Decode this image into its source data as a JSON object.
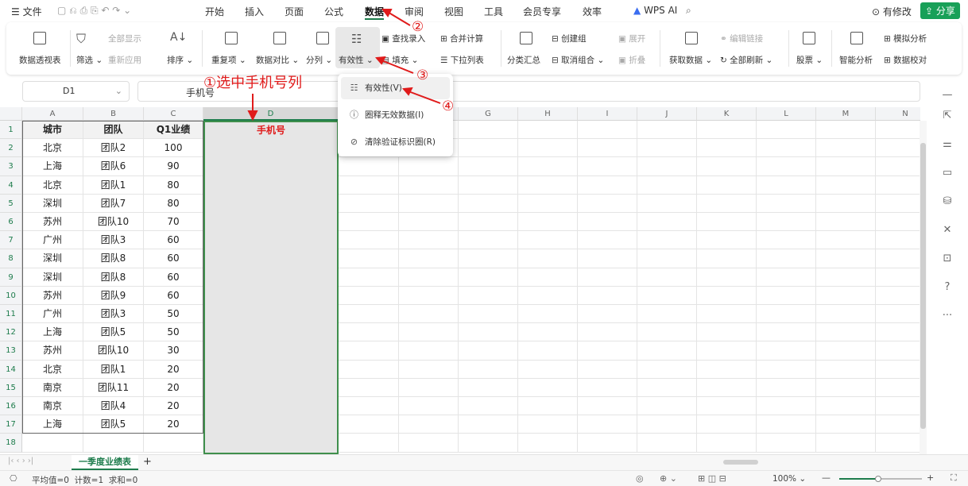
{
  "menu": {
    "hamburger": "☰",
    "file": "文件",
    "tabs": [
      "开始",
      "插入",
      "页面",
      "公式",
      "数据",
      "审阅",
      "视图",
      "工具",
      "会员专享",
      "效率"
    ],
    "active_tab": "数据",
    "wps_ai": "WPS AI",
    "changes": "有修改",
    "share": "分享"
  },
  "ribbon": {
    "pivot": "数据透视表",
    "filter": "筛选",
    "show_all": "全部显示",
    "reapply": "重新应用",
    "sort": "排序",
    "duplicates": "重复项",
    "compare": "数据对比",
    "split": "分列",
    "validity": "有效性",
    "find_input": "查找录入",
    "fill": "填充",
    "merge_calc": "合并计算",
    "dropdown_list": "下拉列表",
    "subtotal": "分类汇总",
    "create_group": "创建组",
    "ungroup": "取消组合",
    "expand": "展开",
    "collapse": "折叠",
    "get_data": "获取数据",
    "edit_links": "编辑链接",
    "refresh_all": "全部刷新",
    "stocks": "股票",
    "smart_analysis": "智能分析",
    "what_if": "模拟分析",
    "data_check": "数据校对"
  },
  "formula_bar": {
    "name_box": "D1",
    "fx": "fx",
    "content": "手机号"
  },
  "dropdown_menu": {
    "items": [
      "有效性(V)",
      "圈释无效数据(I)",
      "清除验证标识圈(R)"
    ]
  },
  "annotations": {
    "step1": "①选中手机号列",
    "step2": "②",
    "step3": "③",
    "step4": "④"
  },
  "sheet": {
    "columns": [
      "A",
      "B",
      "C",
      "D",
      "E",
      "F",
      "G",
      "H",
      "I",
      "J",
      "K",
      "L",
      "M",
      "N"
    ],
    "rows": [
      "1",
      "2",
      "3",
      "4",
      "5",
      "6",
      "7",
      "8",
      "9",
      "10",
      "11",
      "12",
      "13",
      "14",
      "15",
      "16",
      "17",
      "18"
    ],
    "header": [
      "城市",
      "团队",
      "Q1业绩",
      "手机号"
    ],
    "data": [
      [
        "北京",
        "团队2",
        "100"
      ],
      [
        "上海",
        "团队6",
        "90"
      ],
      [
        "北京",
        "团队1",
        "80"
      ],
      [
        "深圳",
        "团队7",
        "80"
      ],
      [
        "苏州",
        "团队10",
        "70"
      ],
      [
        "广州",
        "团队3",
        "60"
      ],
      [
        "深圳",
        "团队8",
        "60"
      ],
      [
        "深圳",
        "团队8",
        "60"
      ],
      [
        "苏州",
        "团队9",
        "60"
      ],
      [
        "广州",
        "团队3",
        "50"
      ],
      [
        "上海",
        "团队5",
        "50"
      ],
      [
        "苏州",
        "团队10",
        "30"
      ],
      [
        "北京",
        "团队1",
        "20"
      ],
      [
        "南京",
        "团队11",
        "20"
      ],
      [
        "南京",
        "团队4",
        "20"
      ],
      [
        "上海",
        "团队5",
        "20"
      ]
    ]
  },
  "sheet_tab": "一季度业绩表",
  "status": {
    "summary": "平均值=0  计数=1  求和=0",
    "zoom": "100%"
  },
  "colors": {
    "accent": "#1e7c4c",
    "annotation": "#e01b1b",
    "share_bg": "#18a058"
  }
}
